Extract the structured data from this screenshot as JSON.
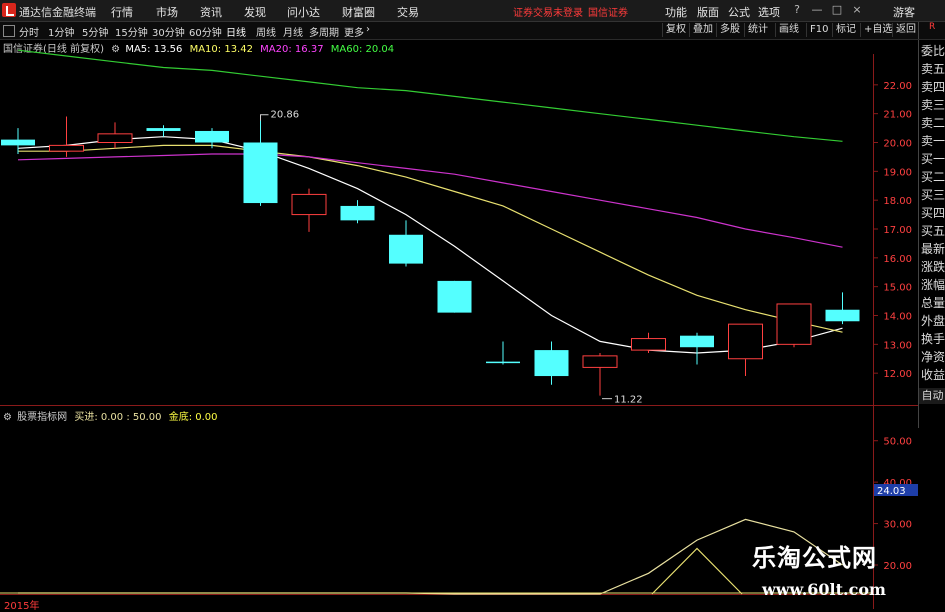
{
  "app": {
    "title": "通达信金融终端",
    "menu": [
      "行情",
      "市场",
      "资讯",
      "发现",
      "问小达",
      "财富圈",
      "交易"
    ],
    "status_not_logged": "证券交易未登录",
    "broker": "国信证券",
    "right_menu": [
      "功能",
      "版面",
      "公式",
      "选项"
    ],
    "guest": "游客",
    "window_controls": [
      "?",
      "—",
      "□",
      "×"
    ]
  },
  "period_bar": {
    "periods": [
      "分时",
      "1分钟",
      "5分钟",
      "15分钟",
      "30分钟",
      "60分钟",
      "日线",
      "周线",
      "月线",
      "多周期",
      "更多"
    ],
    "active": "日线",
    "tools": [
      "复权",
      "叠加",
      "多股",
      "统计",
      "画线",
      "F10",
      "标记",
      "+自选",
      "返回"
    ]
  },
  "main_chart": {
    "stock_label": "国信证券(日线 前复权)",
    "ma": [
      {
        "name": "MA5",
        "value": "13.56",
        "color": "#ffffff"
      },
      {
        "name": "MA10",
        "value": "13.42",
        "color": "#ffff66"
      },
      {
        "name": "MA20",
        "value": "16.37",
        "color": "#ff44ff"
      },
      {
        "name": "MA60",
        "value": "20.04",
        "color": "#44ff44"
      }
    ],
    "y_ticks": [
      "22.00",
      "21.00",
      "20.00",
      "19.00",
      "18.00",
      "17.00",
      "16.00",
      "15.00",
      "14.00",
      "13.00",
      "12.00"
    ],
    "high_mark": "20.86",
    "low_mark": "11.22"
  },
  "indicator": {
    "label": "股票指标网",
    "line1": "买进: 0.00 : 50.00",
    "line2_name": "金底",
    "line2_value": "0.00",
    "y_ticks": [
      "50.00",
      "40.00",
      "30.00",
      "20.00"
    ],
    "current_value": "24.03"
  },
  "right_panel": {
    "top_label": "R",
    "items": [
      "委比",
      "卖五",
      "卖四",
      "卖三",
      "卖二",
      "卖一",
      "买一",
      "买二",
      "买三",
      "买四",
      "买五",
      "最新",
      "涨跌",
      "涨幅",
      "总量",
      "外盘",
      "换手",
      "净资",
      "收益"
    ],
    "auto": "自动"
  },
  "footer": {
    "year": "2015年"
  },
  "watermark": {
    "line1": "乐淘公式网",
    "line2": "www.60lt.com"
  },
  "chart_data": [
    {
      "type": "candlestick",
      "title": "国信证券(日线 前复权)",
      "ylim": [
        11.0,
        23.0
      ],
      "y_ticks": [
        12,
        13,
        14,
        15,
        16,
        17,
        18,
        19,
        20,
        21,
        22
      ],
      "candles": [
        {
          "o": 20.1,
          "c": 19.9,
          "h": 20.5,
          "l": 19.6
        },
        {
          "o": 19.7,
          "c": 19.9,
          "h": 20.9,
          "l": 19.5
        },
        {
          "o": 20.0,
          "c": 20.3,
          "h": 20.7,
          "l": 19.8
        },
        {
          "o": 20.5,
          "c": 20.4,
          "h": 20.6,
          "l": 20.2
        },
        {
          "o": 20.4,
          "c": 20.0,
          "h": 20.5,
          "l": 19.8
        },
        {
          "o": 20.0,
          "c": 17.9,
          "h": 20.86,
          "l": 17.8
        },
        {
          "o": 17.5,
          "c": 18.2,
          "h": 18.4,
          "l": 16.9
        },
        {
          "o": 17.8,
          "c": 17.3,
          "h": 18.0,
          "l": 17.2
        },
        {
          "o": 16.8,
          "c": 15.8,
          "h": 17.3,
          "l": 15.7
        },
        {
          "o": 15.2,
          "c": 14.1,
          "h": 15.2,
          "l": 14.1
        },
        {
          "o": 12.4,
          "c": 12.4,
          "h": 13.1,
          "l": 12.3
        },
        {
          "o": 12.8,
          "c": 11.9,
          "h": 13.1,
          "l": 11.6
        },
        {
          "o": 12.2,
          "c": 12.6,
          "h": 12.7,
          "l": 11.22
        },
        {
          "o": 12.8,
          "c": 13.2,
          "h": 13.4,
          "l": 12.7
        },
        {
          "o": 13.3,
          "c": 12.9,
          "h": 13.4,
          "l": 12.3
        },
        {
          "o": 12.5,
          "c": 13.7,
          "h": 13.7,
          "l": 11.9
        },
        {
          "o": 13.0,
          "c": 14.4,
          "h": 14.4,
          "l": 12.9
        },
        {
          "o": 14.2,
          "c": 13.8,
          "h": 14.8,
          "l": 13.7
        }
      ],
      "series": [
        {
          "name": "MA5",
          "color": "#ffffff",
          "values": [
            19.8,
            19.9,
            20.1,
            20.2,
            20.1,
            19.7,
            19.1,
            18.4,
            17.5,
            16.4,
            15.2,
            14.0,
            13.1,
            12.8,
            12.7,
            12.8,
            13.1,
            13.56
          ]
        },
        {
          "name": "MA10",
          "color": "#e8e070",
          "values": [
            19.7,
            19.7,
            19.8,
            19.9,
            19.9,
            19.7,
            19.5,
            19.2,
            18.8,
            18.3,
            17.8,
            17.0,
            16.2,
            15.4,
            14.7,
            14.2,
            13.8,
            13.42
          ]
        },
        {
          "name": "MA20",
          "color": "#cc33cc",
          "values": [
            19.4,
            19.45,
            19.5,
            19.55,
            19.6,
            19.6,
            19.5,
            19.3,
            19.1,
            18.9,
            18.6,
            18.3,
            18.0,
            17.7,
            17.4,
            17.0,
            16.7,
            16.37
          ]
        },
        {
          "name": "MA60",
          "color": "#33cc33",
          "values": [
            23.2,
            23.0,
            22.8,
            22.6,
            22.5,
            22.3,
            22.1,
            21.9,
            21.8,
            21.6,
            21.4,
            21.2,
            21.0,
            20.8,
            20.6,
            20.4,
            20.2,
            20.04
          ]
        }
      ],
      "annotations": [
        {
          "text": "20.86",
          "index": 5,
          "value": 20.86
        },
        {
          "text": "11.22",
          "index": 12,
          "value": 11.22
        }
      ]
    },
    {
      "type": "line",
      "title": "股票指标网",
      "ylim": [
        13,
        55
      ],
      "y_ticks": [
        20,
        30,
        40,
        50
      ],
      "series": [
        {
          "name": "买进",
          "color": "#e8e0a0",
          "values": [
            0,
            0,
            0,
            0,
            0,
            0,
            0,
            0,
            0,
            0.5,
            2,
            5,
            11,
            18,
            26,
            31,
            28,
            20
          ]
        },
        {
          "name": "金底",
          "color": "#e8e070",
          "values": [
            0,
            0,
            0,
            0,
            0,
            0,
            0,
            0,
            0,
            0,
            0,
            0,
            0,
            0,
            24,
            0,
            0,
            0
          ]
        }
      ]
    }
  ]
}
